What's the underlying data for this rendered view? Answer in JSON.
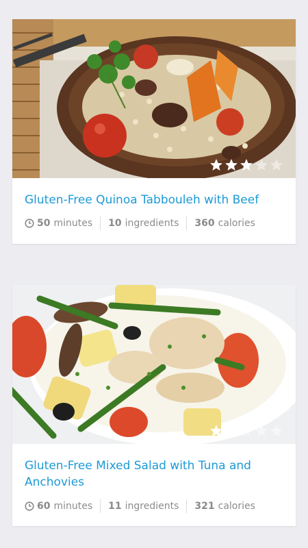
{
  "recipes": [
    {
      "title": "Gluten-Free Quinoa Tabbouleh with Beef",
      "time_value": "50",
      "time_unit": "minutes",
      "ingredients_value": "10",
      "ingredients_unit": "ingredients",
      "calories_value": "360",
      "calories_unit": "calories",
      "rating": 3,
      "rating_max": 5
    },
    {
      "title": "Gluten-Free Mixed Salad with Tuna and Anchovies",
      "time_value": "60",
      "time_unit": "minutes",
      "ingredients_value": "11",
      "ingredients_unit": "ingredients",
      "calories_value": "321",
      "calories_unit": "calories",
      "rating": 2,
      "rating_max": 5
    }
  ],
  "colors": {
    "title": "#1c9ad6",
    "background": "#ececf1",
    "star_filled": "#ffffff",
    "star_empty": "rgba(255,255,255,0.45)"
  },
  "icons": [
    "clock-icon",
    "star-icon"
  ]
}
